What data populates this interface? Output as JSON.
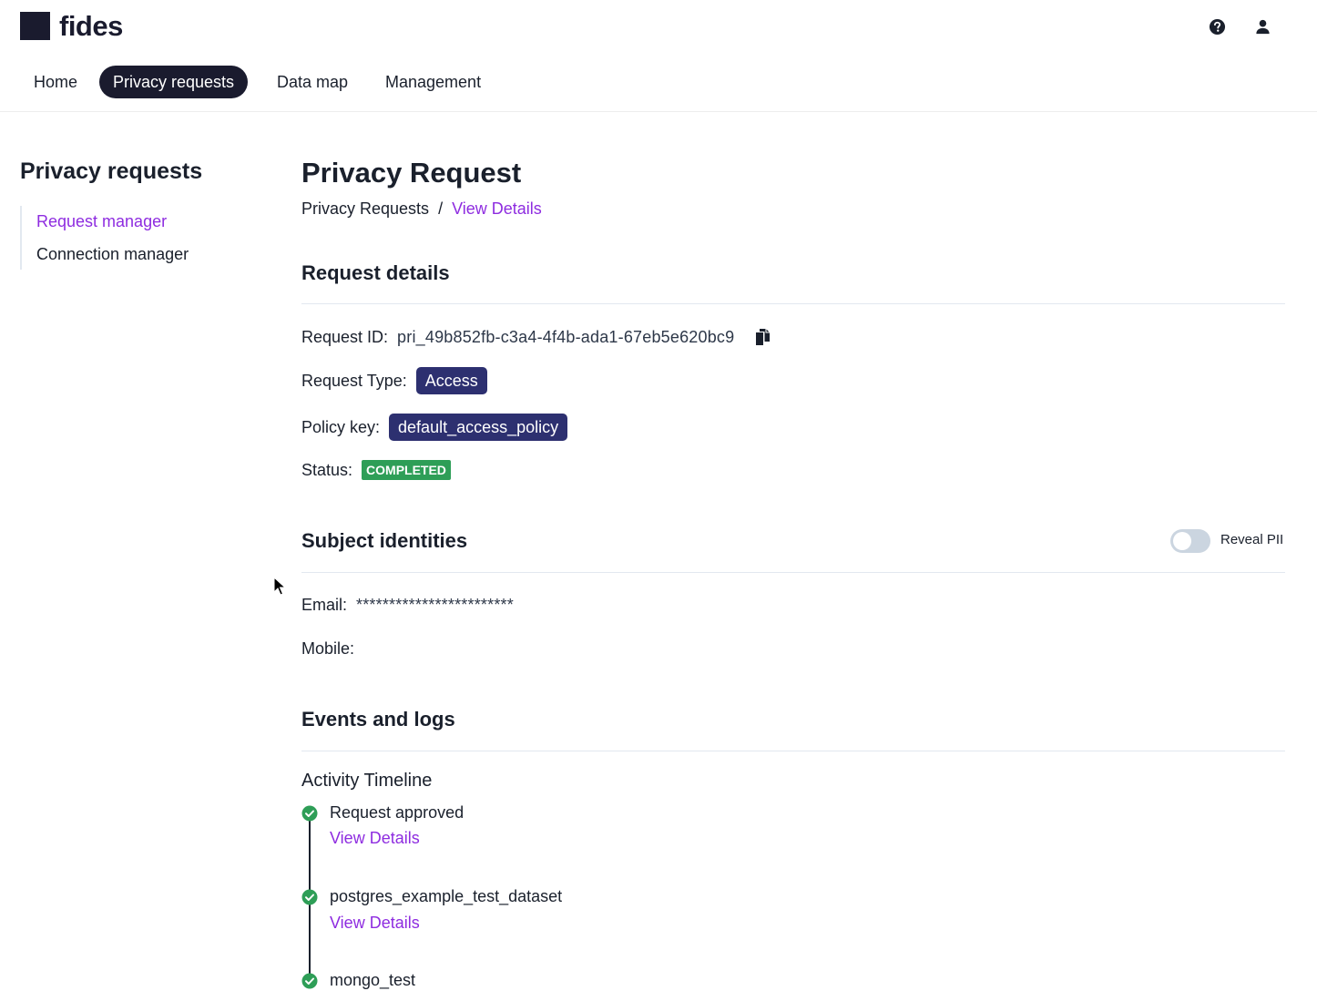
{
  "header": {
    "logo_text": "fides",
    "icons": [
      "help-icon",
      "user-icon"
    ]
  },
  "nav": {
    "items": [
      {
        "label": "Home",
        "active": false
      },
      {
        "label": "Privacy requests",
        "active": true
      },
      {
        "label": "Data map",
        "active": false
      },
      {
        "label": "Management",
        "active": false
      }
    ]
  },
  "sidebar": {
    "title": "Privacy requests",
    "items": [
      {
        "label": "Request manager",
        "active": true
      },
      {
        "label": "Connection manager",
        "active": false
      }
    ]
  },
  "main": {
    "title": "Privacy Request",
    "breadcrumb": {
      "root": "Privacy Requests",
      "separator": "/",
      "current": "View Details"
    },
    "request_details": {
      "title": "Request details",
      "request_id_label": "Request ID:",
      "request_id": "pri_49b852fb-c3a4-4f4b-ada1-67eb5e620bc9",
      "request_type_label": "Request Type:",
      "request_type": "Access",
      "policy_key_label": "Policy key:",
      "policy_key": "default_access_policy",
      "status_label": "Status:",
      "status": "COMPLETED"
    },
    "subject_identities": {
      "title": "Subject identities",
      "reveal_label": "Reveal PII",
      "reveal_on": false,
      "email_label": "Email:",
      "email_value": "************************",
      "mobile_label": "Mobile:",
      "mobile_value": ""
    },
    "events": {
      "title": "Events and logs",
      "timeline_title": "Activity Timeline",
      "items": [
        {
          "label": "Request approved",
          "link": "View Details"
        },
        {
          "label": "postgres_example_test_dataset",
          "link": "View Details"
        },
        {
          "label": "mongo_test",
          "link": ""
        }
      ]
    }
  },
  "colors": {
    "brand_dark": "#1a1b2e",
    "link_purple": "#8e2ce0",
    "tag_navy": "#2d3070",
    "status_green": "#2e9e57"
  }
}
